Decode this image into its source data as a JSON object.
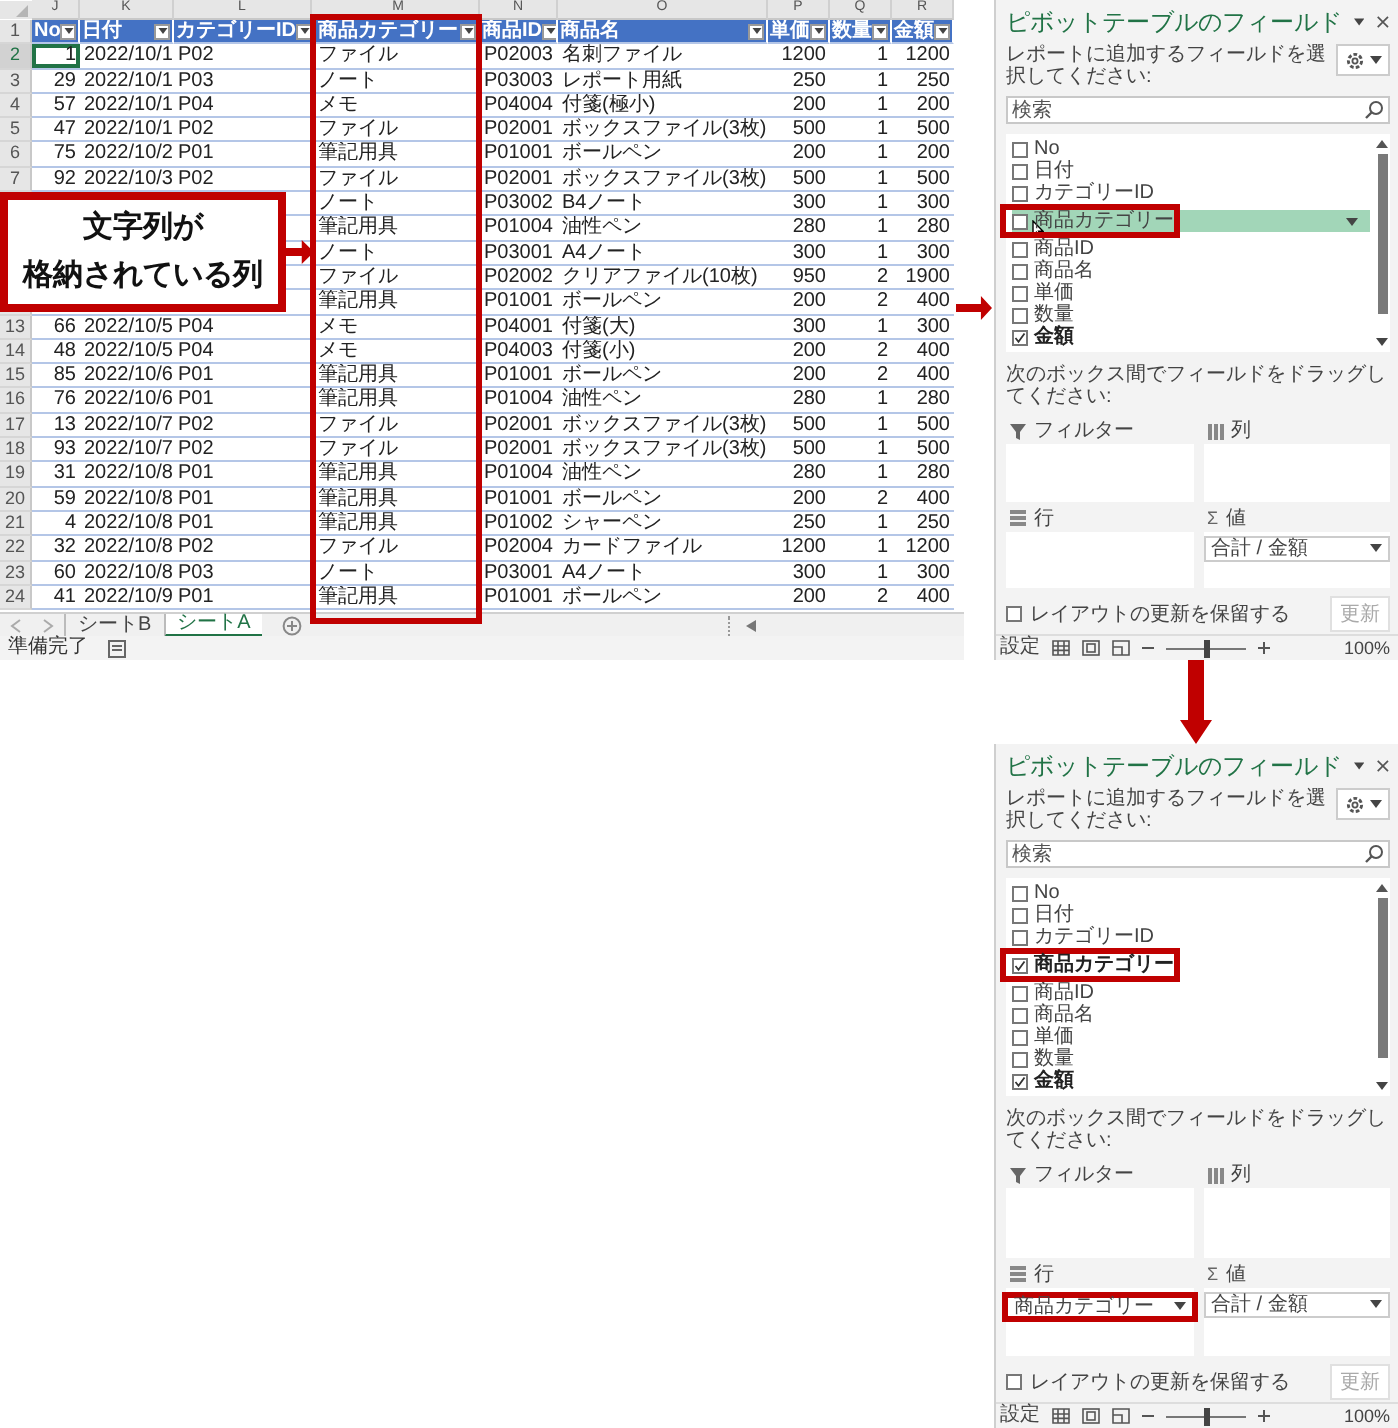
{
  "sheet": {
    "column_letters": [
      "J",
      "K",
      "L",
      "M",
      "N",
      "O",
      "P",
      "Q",
      "R"
    ],
    "header_row_number": "1",
    "columns": [
      {
        "label": "No",
        "highlighted": false
      },
      {
        "label": "日付",
        "highlighted": false
      },
      {
        "label": "カテゴリーID",
        "highlighted": false
      },
      {
        "label": "商品カテゴリー",
        "highlighted": true
      },
      {
        "label": "商品ID",
        "highlighted": false
      },
      {
        "label": "商品名",
        "highlighted": false
      },
      {
        "label": "単価",
        "highlighted": false
      },
      {
        "label": "数量",
        "highlighted": false
      },
      {
        "label": "金額",
        "highlighted": false
      }
    ],
    "rows": [
      {
        "number": "2",
        "active": true,
        "no": "1",
        "date": "2022/10/1",
        "category_id": "P02",
        "product_category": "ファイル",
        "product_id": "P02003",
        "product_name": "名刺ファイル",
        "unit_price": "1200",
        "quantity": "1",
        "amount": "1200"
      },
      {
        "number": "3",
        "active": false,
        "no": "29",
        "date": "2022/10/1",
        "category_id": "P03",
        "product_category": "ノート",
        "product_id": "P03003",
        "product_name": "レポート用紙",
        "unit_price": "250",
        "quantity": "1",
        "amount": "250"
      },
      {
        "number": "4",
        "active": false,
        "no": "57",
        "date": "2022/10/1",
        "category_id": "P04",
        "product_category": "メモ",
        "product_id": "P04004",
        "product_name": "付箋(極小)",
        "unit_price": "200",
        "quantity": "1",
        "amount": "200"
      },
      {
        "number": "5",
        "active": false,
        "no": "47",
        "date": "2022/10/1",
        "category_id": "P02",
        "product_category": "ファイル",
        "product_id": "P02001",
        "product_name": "ボックスファイル(3枚)",
        "unit_price": "500",
        "quantity": "1",
        "amount": "500"
      },
      {
        "number": "6",
        "active": false,
        "no": "75",
        "date": "2022/10/2",
        "category_id": "P01",
        "product_category": "筆記用具",
        "product_id": "P01001",
        "product_name": "ボールペン",
        "unit_price": "200",
        "quantity": "1",
        "amount": "200"
      },
      {
        "number": "7",
        "active": false,
        "no": "92",
        "date": "2022/10/3",
        "category_id": "P02",
        "product_category": "ファイル",
        "product_id": "P02001",
        "product_name": "ボックスファイル(3枚)",
        "unit_price": "500",
        "quantity": "1",
        "amount": "500"
      },
      {
        "active": false,
        "product_category": "ノート",
        "product_id": "P03002",
        "product_name": "B4ノート",
        "unit_price": "300",
        "quantity": "1",
        "amount": "300"
      },
      {
        "active": false,
        "product_category": "筆記用具",
        "product_id": "P01004",
        "product_name": "油性ペン",
        "unit_price": "280",
        "quantity": "1",
        "amount": "280"
      },
      {
        "active": false,
        "product_category": "ノート",
        "product_id": "P03001",
        "product_name": "A4ノート",
        "unit_price": "300",
        "quantity": "1",
        "amount": "300"
      },
      {
        "active": false,
        "product_category": "ファイル",
        "product_id": "P02002",
        "product_name": "クリアファイル(10枚)",
        "unit_price": "950",
        "quantity": "2",
        "amount": "1900"
      },
      {
        "active": false,
        "product_category": "筆記用具",
        "product_id": "P01001",
        "product_name": "ボールペン",
        "unit_price": "200",
        "quantity": "2",
        "amount": "400"
      },
      {
        "number": "13",
        "active": false,
        "no": "66",
        "date": "2022/10/5",
        "category_id": "P04",
        "product_category": "メモ",
        "product_id": "P04001",
        "product_name": "付箋(大)",
        "unit_price": "300",
        "quantity": "1",
        "amount": "300"
      },
      {
        "number": "14",
        "active": false,
        "no": "48",
        "date": "2022/10/5",
        "category_id": "P04",
        "product_category": "メモ",
        "product_id": "P04003",
        "product_name": "付箋(小)",
        "unit_price": "200",
        "quantity": "2",
        "amount": "400"
      },
      {
        "number": "15",
        "active": false,
        "no": "85",
        "date": "2022/10/6",
        "category_id": "P01",
        "product_category": "筆記用具",
        "product_id": "P01001",
        "product_name": "ボールペン",
        "unit_price": "200",
        "quantity": "2",
        "amount": "400"
      },
      {
        "number": "16",
        "active": false,
        "no": "76",
        "date": "2022/10/6",
        "category_id": "P01",
        "product_category": "筆記用具",
        "product_id": "P01004",
        "product_name": "油性ペン",
        "unit_price": "280",
        "quantity": "1",
        "amount": "280"
      },
      {
        "number": "17",
        "active": false,
        "no": "13",
        "date": "2022/10/7",
        "category_id": "P02",
        "product_category": "ファイル",
        "product_id": "P02001",
        "product_name": "ボックスファイル(3枚)",
        "unit_price": "500",
        "quantity": "1",
        "amount": "500"
      },
      {
        "number": "18",
        "active": false,
        "no": "93",
        "date": "2022/10/7",
        "category_id": "P02",
        "product_category": "ファイル",
        "product_id": "P02001",
        "product_name": "ボックスファイル(3枚)",
        "unit_price": "500",
        "quantity": "1",
        "amount": "500"
      },
      {
        "number": "19",
        "active": false,
        "no": "31",
        "date": "2022/10/8",
        "category_id": "P01",
        "product_category": "筆記用具",
        "product_id": "P01004",
        "product_name": "油性ペン",
        "unit_price": "280",
        "quantity": "1",
        "amount": "280"
      },
      {
        "number": "20",
        "active": false,
        "no": "59",
        "date": "2022/10/8",
        "category_id": "P01",
        "product_category": "筆記用具",
        "product_id": "P01001",
        "product_name": "ボールペン",
        "unit_price": "200",
        "quantity": "2",
        "amount": "400"
      },
      {
        "number": "21",
        "active": false,
        "no": "4",
        "date": "2022/10/8",
        "category_id": "P01",
        "product_category": "筆記用具",
        "product_id": "P01002",
        "product_name": "シャーペン",
        "unit_price": "250",
        "quantity": "1",
        "amount": "250"
      },
      {
        "number": "22",
        "active": false,
        "no": "32",
        "date": "2022/10/8",
        "category_id": "P02",
        "product_category": "ファイル",
        "product_id": "P02004",
        "product_name": "カードファイル",
        "unit_price": "1200",
        "quantity": "1",
        "amount": "1200"
      },
      {
        "number": "23",
        "active": false,
        "no": "60",
        "date": "2022/10/8",
        "category_id": "P03",
        "product_category": "ノート",
        "product_id": "P03001",
        "product_name": "A4ノート",
        "unit_price": "300",
        "quantity": "1",
        "amount": "300"
      },
      {
        "number": "24",
        "active": false,
        "no": "41",
        "date": "2022/10/9",
        "category_id": "P01",
        "product_category": "筆記用具",
        "product_id": "P01001",
        "product_name": "ボールペン",
        "unit_price": "200",
        "quantity": "2",
        "amount": "400"
      }
    ],
    "sheet_tabs": [
      {
        "label": "シートB",
        "selected": false
      },
      {
        "label": "シートA",
        "selected": true
      }
    ],
    "status": "準備完了"
  },
  "callout": {
    "lines": [
      "文字列が",
      "格納されている列"
    ]
  },
  "pivot_panels": [
    {
      "title": "ピボットテーブルのフィールド",
      "instruction": "レポートに追加するフィールドを選択してください:",
      "search": {
        "placeholder": "検索"
      },
      "fields": [
        {
          "label": "No",
          "checked": false,
          "dragging": false,
          "highlighted": false
        },
        {
          "label": "日付",
          "checked": false,
          "dragging": false,
          "highlighted": false
        },
        {
          "label": "カテゴリーID",
          "checked": false,
          "dragging": false,
          "highlighted": false
        },
        {
          "label": "商品カテゴリー",
          "checked": false,
          "dragging": true,
          "highlighted": true
        },
        {
          "label": "商品ID",
          "checked": false,
          "dragging": false,
          "highlighted": false
        },
        {
          "label": "商品名",
          "checked": false,
          "dragging": false,
          "highlighted": false
        },
        {
          "label": "単価",
          "checked": false,
          "dragging": false,
          "highlighted": false
        },
        {
          "label": "数量",
          "checked": false,
          "dragging": false,
          "highlighted": false
        },
        {
          "label": "金額",
          "checked": true,
          "dragging": false,
          "highlighted": false
        }
      ],
      "areas_instruction": "次のボックス間でフィールドをドラッグしてください:",
      "areas": [
        {
          "kind": "filter",
          "label": "フィルター"
        },
        {
          "kind": "columns",
          "label": "列"
        },
        {
          "kind": "rows",
          "label": "行"
        },
        {
          "kind": "values",
          "symbol": "Σ",
          "label": "値",
          "items": [
            {
              "label": "合計 / 金額",
              "highlighted": false
            }
          ]
        }
      ],
      "defer": {
        "label": "レイアウトの更新を保留する",
        "checked": false
      },
      "update_button": {
        "label": "更新",
        "disabled": true
      },
      "status": {
        "label": "設定",
        "zoom_slider": {
          "level": 0.5
        },
        "zoom": "100%"
      }
    },
    {
      "title": "ピボットテーブルのフィールド",
      "instruction": "レポートに追加するフィールドを選択してください:",
      "search": {
        "placeholder": "検索"
      },
      "fields": [
        {
          "label": "No",
          "checked": false,
          "dragging": false,
          "highlighted": false
        },
        {
          "label": "日付",
          "checked": false,
          "dragging": false,
          "highlighted": false
        },
        {
          "label": "カテゴリーID",
          "checked": false,
          "dragging": false,
          "highlighted": false
        },
        {
          "label": "商品カテゴリー",
          "checked": true,
          "dragging": false,
          "highlighted": true
        },
        {
          "label": "商品ID",
          "checked": false,
          "dragging": false,
          "highlighted": false
        },
        {
          "label": "商品名",
          "checked": false,
          "dragging": false,
          "highlighted": false
        },
        {
          "label": "単価",
          "checked": false,
          "dragging": false,
          "highlighted": false
        },
        {
          "label": "数量",
          "checked": false,
          "dragging": false,
          "highlighted": false
        },
        {
          "label": "金額",
          "checked": true,
          "dragging": false,
          "highlighted": false
        }
      ],
      "areas_instruction": "次のボックス間でフィールドをドラッグしてください:",
      "areas": [
        {
          "kind": "filter",
          "label": "フィルター"
        },
        {
          "kind": "columns",
          "label": "列"
        },
        {
          "kind": "rows",
          "label": "行",
          "items": [
            {
              "label": "商品カテゴリー",
              "highlighted": true
            }
          ]
        },
        {
          "kind": "values",
          "symbol": "Σ",
          "label": "値",
          "items": [
            {
              "label": "合計 / 金額",
              "highlighted": false
            }
          ]
        }
      ],
      "defer": {
        "label": "レイアウトの更新を保留する",
        "checked": false
      },
      "update_button": {
        "label": "更新",
        "disabled": true
      },
      "status": {
        "label": "設定",
        "zoom_slider": {
          "level": 0.5
        },
        "zoom": "100%"
      }
    }
  ]
}
